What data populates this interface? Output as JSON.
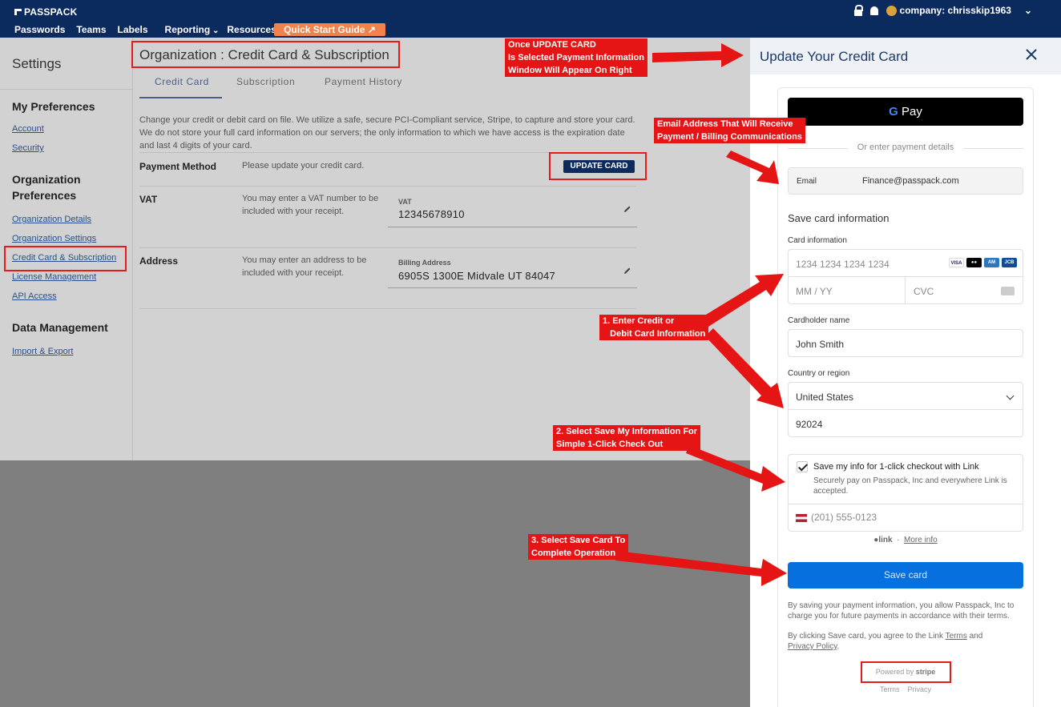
{
  "nav": {
    "logo": "PASSPACK",
    "links": [
      "Passwords",
      "Teams",
      "Labels",
      "Reporting",
      "Resources"
    ],
    "quick_start": "Quick Start Guide ↗",
    "company": "company: chrisskip1963"
  },
  "sidebar": {
    "title": "Settings",
    "sections": [
      {
        "heading": "My Preferences",
        "items": [
          "Account",
          "Security"
        ]
      },
      {
        "heading": "Organization Preferences",
        "items": [
          "Organization Details",
          "Organization Settings",
          "Credit Card & Subscription",
          "License Management",
          "API Access"
        ]
      },
      {
        "heading": "Data Management",
        "items": [
          "Import & Export"
        ]
      }
    ]
  },
  "main": {
    "title": "Organization : Credit Card & Subscription",
    "tabs": [
      "Credit Card",
      "Subscription",
      "Payment History"
    ],
    "description": "Change your credit or debit card on file. We utilize a safe, secure PCI-Compliant service, Stripe, to capture and store your card. We do not store your full card information on our servers; the only information to which we have access is the expiration date and last 4 digits of your card.",
    "payment_method": {
      "label": "Payment Method",
      "help": "Please update your credit card.",
      "button": "UPDATE CARD"
    },
    "vat": {
      "label": "VAT",
      "help": "You may enter a VAT number to be included with your receipt.",
      "field_label": "VAT",
      "value": "12345678910"
    },
    "address": {
      "label": "Address",
      "help": "You may enter an address to be included with your receipt.",
      "field_label": "Billing Address",
      "value": "6905S 1300E Midvale UT 84047"
    }
  },
  "panel": {
    "title": "Update Your Credit Card",
    "gpay": "Pay",
    "or_text": "Or enter payment details",
    "email_label": "Email",
    "email_value": "Finance@passpack.com",
    "save_card_info": "Save card information",
    "card_info_label": "Card information",
    "card_number_placeholder": "1234 1234 1234 1234",
    "expiry_placeholder": "MM / YY",
    "cvc_placeholder": "CVC",
    "cardholder_label": "Cardholder name",
    "cardholder_value": "John Smith",
    "country_label": "Country or region",
    "country_value": "United States",
    "zip_value": "92024",
    "save_info_title": "Save my info for 1-click checkout with Link",
    "save_info_sub": "Securely pay on Passpack, Inc and everywhere Link is accepted.",
    "phone_placeholder": "(201) 555-0123",
    "link_text": "link",
    "more_info": "More info",
    "save_button": "Save card",
    "legal1": "By saving your payment information, you allow Passpack, Inc to charge you for future payments in accordance with their terms.",
    "legal2_prefix": "By clicking Save card, you agree to the Link",
    "legal2_terms": "Terms",
    "legal2_and": "and",
    "legal2_privacy": "Privacy Policy",
    "powered": "Powered by",
    "stripe": "stripe",
    "terms": "Terms",
    "privacy": "Privacy"
  },
  "annotations": {
    "a1": "Once UPDATE CARD\nIs Selected Payment Information\nWindow Will Appear On Right",
    "a2": "Email Address That Will Receive\nPayment / Billing Communications",
    "a3": "1. Enter Credit or\n   Debit Card Information",
    "a4": "2. Select Save My Information For\nSimple 1-Click Check Out",
    "a5": "3. Select Save Card To\nComplete Operation"
  },
  "colors": {
    "nav": "#0b2a5e",
    "accent": "#f0824c",
    "annotation": "#e51515",
    "save_button": "#0570de"
  }
}
